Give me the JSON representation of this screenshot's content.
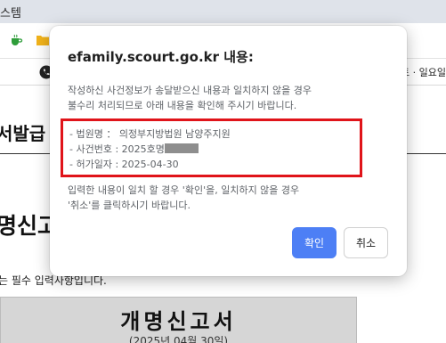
{
  "window": {
    "title_fragment": "스템"
  },
  "info_bar": {
    "right_text": "토 · 일요일"
  },
  "background": {
    "heading_fragment": "서발급",
    "form_title_fragment": "명신고",
    "required_note_fragment": "는 필수 입력사항입니다.",
    "form_box_title": "개명신고서",
    "form_box_subtitle": "(2025년 04월 30일)"
  },
  "dialog": {
    "title": "efamily.scourt.go.kr 내용:",
    "message_lines": [
      "작성하신 사건정보가 송달받으신 내용과 일치하지 않을 경우",
      "불수리 처리되므로 아래 내용을 확인해 주시기 바랍니다."
    ],
    "details": {
      "court": "- 법원명 ： 의정부지방법원 남양주지원",
      "case_number_prefix": "- 사건번호 : 2025호명",
      "permit_date": "- 허가일자 : 2025-04-30"
    },
    "footer_lines": [
      "입력한 내용이 일치 할 경우 '확인'을, 일치하지 않을 경우",
      "'취소'를 클릭하시기 바랍니다."
    ],
    "ok_label": "확인",
    "cancel_label": "취소"
  },
  "colors": {
    "accent": "#4d7ff5",
    "highlight_border": "#e0141a",
    "message_text": "#5f6368"
  },
  "icons": [
    "coffee-cup-icon",
    "folder-icon",
    "phone-icon"
  ]
}
